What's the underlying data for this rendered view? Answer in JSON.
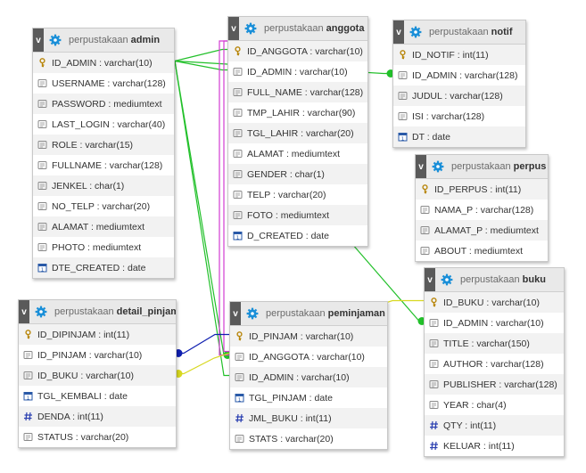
{
  "db_name": "perpustakaan",
  "colors": {
    "link_green": "#22c02a",
    "link_magenta": "#d23cd2",
    "link_blue": "#1020b0",
    "link_yellow": "#d8d820",
    "gear_blue": "#1a8fd8"
  },
  "tables": [
    {
      "id": "admin",
      "name": "admin",
      "columns": [
        {
          "text": "ID_ADMIN : varchar(10)",
          "icon": "key"
        },
        {
          "text": "USERNAME : varchar(128)",
          "icon": "field"
        },
        {
          "text": "PASSWORD : mediumtext",
          "icon": "field"
        },
        {
          "text": "LAST_LOGIN : varchar(40)",
          "icon": "field"
        },
        {
          "text": "ROLE : varchar(15)",
          "icon": "field"
        },
        {
          "text": "FULLNAME : varchar(128)",
          "icon": "field"
        },
        {
          "text": "JENKEL : char(1)",
          "icon": "field"
        },
        {
          "text": "NO_TELP : varchar(20)",
          "icon": "field"
        },
        {
          "text": "ALAMAT : mediumtext",
          "icon": "field"
        },
        {
          "text": "PHOTO : mediumtext",
          "icon": "field"
        },
        {
          "text": "DTE_CREATED : date",
          "icon": "date"
        }
      ]
    },
    {
      "id": "anggota",
      "name": "anggota",
      "columns": [
        {
          "text": "ID_ANGGOTA : varchar(10)",
          "icon": "key"
        },
        {
          "text": "ID_ADMIN : varchar(10)",
          "icon": "field"
        },
        {
          "text": "FULL_NAME : varchar(128)",
          "icon": "field"
        },
        {
          "text": "TMP_LAHIR : varchar(90)",
          "icon": "field"
        },
        {
          "text": "TGL_LAHIR : varchar(20)",
          "icon": "field"
        },
        {
          "text": "ALAMAT : mediumtext",
          "icon": "field"
        },
        {
          "text": "GENDER : char(1)",
          "icon": "field"
        },
        {
          "text": "TELP : varchar(20)",
          "icon": "field"
        },
        {
          "text": "FOTO : mediumtext",
          "icon": "field"
        },
        {
          "text": "D_CREATED : date",
          "icon": "date"
        }
      ]
    },
    {
      "id": "notif",
      "name": "notif",
      "columns": [
        {
          "text": "ID_NOTIF : int(11)",
          "icon": "key"
        },
        {
          "text": "ID_ADMIN : varchar(128)",
          "icon": "field"
        },
        {
          "text": "JUDUL : varchar(128)",
          "icon": "field"
        },
        {
          "text": "ISI : varchar(128)",
          "icon": "field"
        },
        {
          "text": "DT : date",
          "icon": "date"
        }
      ]
    },
    {
      "id": "perpus",
      "name": "perpus",
      "columns": [
        {
          "text": "ID_PERPUS : int(11)",
          "icon": "key"
        },
        {
          "text": "NAMA_P : varchar(128)",
          "icon": "field"
        },
        {
          "text": "ALAMAT_P : mediumtext",
          "icon": "field"
        },
        {
          "text": "ABOUT : mediumtext",
          "icon": "field"
        }
      ]
    },
    {
      "id": "detail_pinjam",
      "name": "detail_pinjam",
      "columns": [
        {
          "text": "ID_DIPINJAM : int(11)",
          "icon": "key"
        },
        {
          "text": "ID_PINJAM : varchar(10)",
          "icon": "field"
        },
        {
          "text": "ID_BUKU : varchar(10)",
          "icon": "field"
        },
        {
          "text": "TGL_KEMBALI : date",
          "icon": "date"
        },
        {
          "text": "DENDA : int(11)",
          "icon": "num"
        },
        {
          "text": "STATUS : varchar(20)",
          "icon": "field"
        }
      ]
    },
    {
      "id": "peminjaman",
      "name": "peminjaman",
      "columns": [
        {
          "text": "ID_PINJAM : varchar(10)",
          "icon": "key"
        },
        {
          "text": "ID_ANGGOTA : varchar(10)",
          "icon": "field"
        },
        {
          "text": "ID_ADMIN : varchar(10)",
          "icon": "field"
        },
        {
          "text": "TGL_PINJAM : date",
          "icon": "date"
        },
        {
          "text": "JML_BUKU : int(11)",
          "icon": "num"
        },
        {
          "text": "STATS : varchar(20)",
          "icon": "field"
        }
      ]
    },
    {
      "id": "buku",
      "name": "buku",
      "columns": [
        {
          "text": "ID_BUKU : varchar(10)",
          "icon": "key"
        },
        {
          "text": "ID_ADMIN : varchar(10)",
          "icon": "field"
        },
        {
          "text": "TITLE : varchar(150)",
          "icon": "field"
        },
        {
          "text": "AUTHOR : varchar(128)",
          "icon": "field"
        },
        {
          "text": "PUBLISHER : varchar(128)",
          "icon": "field"
        },
        {
          "text": "YEAR : char(4)",
          "icon": "field"
        },
        {
          "text": "QTY : int(11)",
          "icon": "num"
        },
        {
          "text": "KELUAR : int(11)",
          "icon": "num"
        }
      ]
    }
  ]
}
